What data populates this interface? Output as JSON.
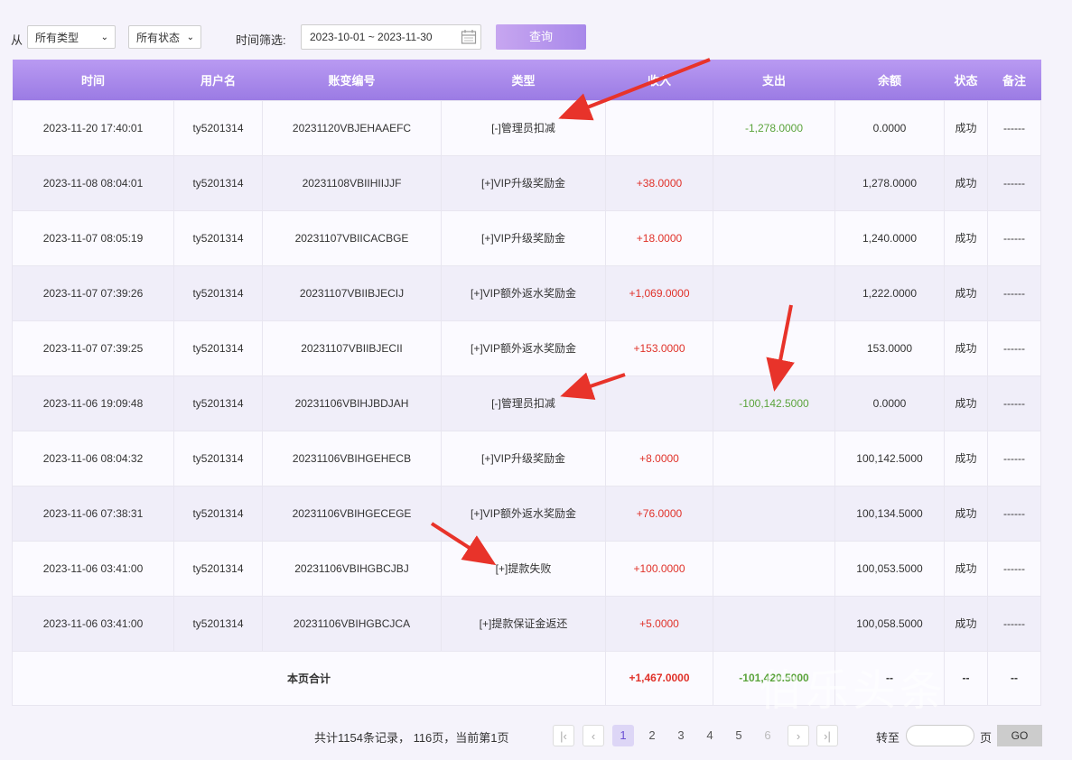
{
  "filters": {
    "from_label": "从",
    "type_select": "所有类型",
    "status_select": "所有状态",
    "time_label": "时间筛选:",
    "date_range": "2023-10-01 ~ 2023-11-30",
    "query_button": "查询"
  },
  "table": {
    "headers": [
      "时间",
      "用户名",
      "账变编号",
      "类型",
      "收入",
      "支出",
      "余额",
      "状态",
      "备注"
    ],
    "rows": [
      {
        "time": "2023-11-20 17:40:01",
        "user": "ty5201314",
        "id": "20231120VBJEHAAEFC",
        "type": "[-]管理员扣减",
        "income": "",
        "expense": "-1,278.0000",
        "balance": "0.0000",
        "status": "成功",
        "note": "------"
      },
      {
        "time": "2023-11-08 08:04:01",
        "user": "ty5201314",
        "id": "20231108VBIIHIIJJF",
        "type": "[+]VIP升级奖励金",
        "income": "+38.0000",
        "expense": "",
        "balance": "1,278.0000",
        "status": "成功",
        "note": "------"
      },
      {
        "time": "2023-11-07 08:05:19",
        "user": "ty5201314",
        "id": "20231107VBIICACBGE",
        "type": "[+]VIP升级奖励金",
        "income": "+18.0000",
        "expense": "",
        "balance": "1,240.0000",
        "status": "成功",
        "note": "------"
      },
      {
        "time": "2023-11-07 07:39:26",
        "user": "ty5201314",
        "id": "20231107VBIIBJECIJ",
        "type": "[+]VIP额外返水奖励金",
        "income": "+1,069.0000",
        "expense": "",
        "balance": "1,222.0000",
        "status": "成功",
        "note": "------"
      },
      {
        "time": "2023-11-07 07:39:25",
        "user": "ty5201314",
        "id": "20231107VBIIBJECII",
        "type": "[+]VIP额外返水奖励金",
        "income": "+153.0000",
        "expense": "",
        "balance": "153.0000",
        "status": "成功",
        "note": "------"
      },
      {
        "time": "2023-11-06 19:09:48",
        "user": "ty5201314",
        "id": "20231106VBIHJBDJAH",
        "type": "[-]管理员扣减",
        "income": "",
        "expense": "-100,142.5000",
        "balance": "0.0000",
        "status": "成功",
        "note": "------"
      },
      {
        "time": "2023-11-06 08:04:32",
        "user": "ty5201314",
        "id": "20231106VBIHGEHECB",
        "type": "[+]VIP升级奖励金",
        "income": "+8.0000",
        "expense": "",
        "balance": "100,142.5000",
        "status": "成功",
        "note": "------"
      },
      {
        "time": "2023-11-06 07:38:31",
        "user": "ty5201314",
        "id": "20231106VBIHGECEGE",
        "type": "[+]VIP额外返水奖励金",
        "income": "+76.0000",
        "expense": "",
        "balance": "100,134.5000",
        "status": "成功",
        "note": "------"
      },
      {
        "time": "2023-11-06 03:41:00",
        "user": "ty5201314",
        "id": "20231106VBIHGBCJBJ",
        "type": "[+]提款失败",
        "income": "+100.0000",
        "expense": "",
        "balance": "100,053.5000",
        "status": "成功",
        "note": "------"
      },
      {
        "time": "2023-11-06 03:41:00",
        "user": "ty5201314",
        "id": "20231106VBIHGBCJCA",
        "type": "[+]提款保证金返还",
        "income": "+5.0000",
        "expense": "",
        "balance": "100,058.5000",
        "status": "成功",
        "note": "------"
      }
    ],
    "total": {
      "label": "本页合计",
      "income": "+1,467.0000",
      "expense": "-101,420.5000",
      "balance": "--",
      "status": "--",
      "note": "--"
    }
  },
  "pagination": {
    "summary": "共计1154条记录， 116页，当前第1页",
    "pages": [
      "1",
      "2",
      "3",
      "4",
      "5",
      "6"
    ],
    "current_page": "1",
    "goto_label": "转至",
    "page_suffix": "页",
    "go_button": "GO"
  },
  "watermark": "伯乐头条",
  "colors": {
    "header": "#a888ea",
    "income": "#e0322a",
    "expense": "#5ba43c",
    "arrow": "#e8332a"
  }
}
